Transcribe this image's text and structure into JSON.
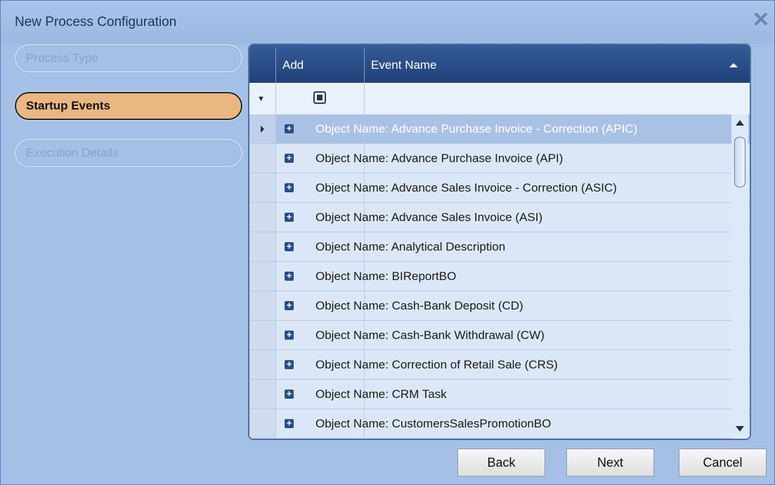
{
  "window": {
    "title": "New Process Configuration",
    "close_glyph": "✕"
  },
  "steps": [
    {
      "label": "Process Type",
      "state": "inactive"
    },
    {
      "label": "Startup Events",
      "state": "active"
    },
    {
      "label": "Execution Details",
      "state": "inactive"
    }
  ],
  "grid": {
    "columns": {
      "add": "Add",
      "event_name": "Event Name"
    },
    "sort": "ascending",
    "rows": [
      "Object Name: Advance Purchase Invoice - Correction (APIC)",
      "Object Name: Advance Purchase Invoice (API)",
      "Object Name: Advance Sales Invoice - Correction (ASIC)",
      "Object Name: Advance Sales Invoice (ASI)",
      "Object Name: Analytical Description",
      "Object Name: BIReportBO",
      "Object Name: Cash-Bank Deposit (CD)",
      "Object Name: Cash-Bank Withdrawal (CW)",
      "Object Name: Correction of Retail Sale (CRS)",
      "Object Name: CRM Task",
      "Object Name: CustomersSalesPromotionBO"
    ],
    "selected_row_index": 0,
    "expand_glyph": "+",
    "filter_glyph": "▼"
  },
  "buttons": {
    "back": "Back",
    "next": "Next",
    "cancel": "Cancel"
  },
  "colors": {
    "accent_step": "#e9b782",
    "header": "#2a4e86",
    "window_bg": "#a5c0e6"
  }
}
